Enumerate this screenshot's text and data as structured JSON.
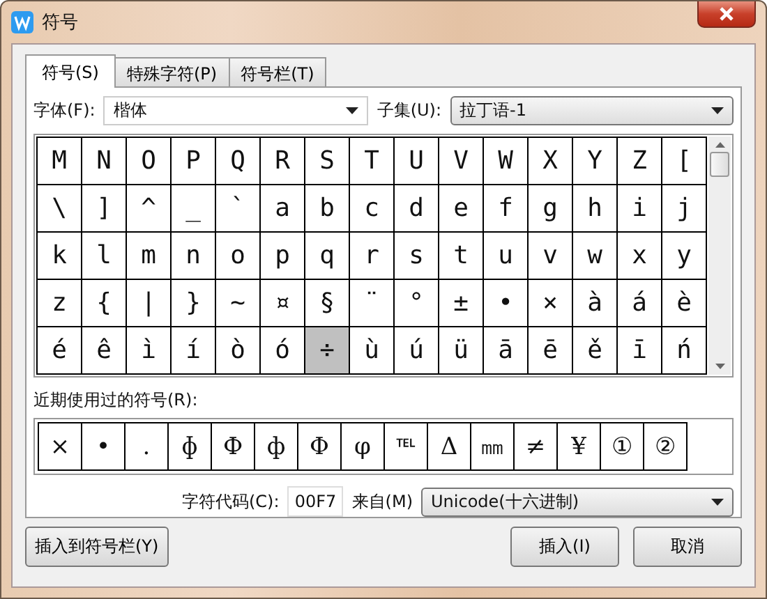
{
  "window": {
    "title": "符号"
  },
  "tabs": [
    {
      "label": "符号(S)",
      "selected": true
    },
    {
      "label": "特殊字符(P)",
      "selected": false
    },
    {
      "label": "符号栏(T)",
      "selected": false
    }
  ],
  "font": {
    "label": "字体(F):",
    "value": "楷体"
  },
  "subset": {
    "label": "子集(U):",
    "value": "拉丁语-1"
  },
  "symbol_grid": [
    [
      {
        "char": "M",
        "selected": false
      },
      {
        "char": "N",
        "selected": false
      },
      {
        "char": "O",
        "selected": false
      },
      {
        "char": "P",
        "selected": false
      },
      {
        "char": "Q",
        "selected": false
      },
      {
        "char": "R",
        "selected": false
      },
      {
        "char": "S",
        "selected": false
      },
      {
        "char": "T",
        "selected": false
      },
      {
        "char": "U",
        "selected": false
      },
      {
        "char": "V",
        "selected": false
      },
      {
        "char": "W",
        "selected": false
      },
      {
        "char": "X",
        "selected": false
      },
      {
        "char": "Y",
        "selected": false
      },
      {
        "char": "Z",
        "selected": false
      },
      {
        "char": "[",
        "selected": false
      }
    ],
    [
      {
        "char": "\\",
        "selected": false
      },
      {
        "char": "]",
        "selected": false
      },
      {
        "char": "^",
        "selected": false
      },
      {
        "char": "_",
        "selected": false
      },
      {
        "char": "`",
        "selected": false
      },
      {
        "char": "a",
        "selected": false
      },
      {
        "char": "b",
        "selected": false
      },
      {
        "char": "c",
        "selected": false
      },
      {
        "char": "d",
        "selected": false
      },
      {
        "char": "e",
        "selected": false
      },
      {
        "char": "f",
        "selected": false
      },
      {
        "char": "g",
        "selected": false
      },
      {
        "char": "h",
        "selected": false
      },
      {
        "char": "i",
        "selected": false
      },
      {
        "char": "j",
        "selected": false
      }
    ],
    [
      {
        "char": "k",
        "selected": false
      },
      {
        "char": "l",
        "selected": false
      },
      {
        "char": "m",
        "selected": false
      },
      {
        "char": "n",
        "selected": false
      },
      {
        "char": "o",
        "selected": false
      },
      {
        "char": "p",
        "selected": false
      },
      {
        "char": "q",
        "selected": false
      },
      {
        "char": "r",
        "selected": false
      },
      {
        "char": "s",
        "selected": false
      },
      {
        "char": "t",
        "selected": false
      },
      {
        "char": "u",
        "selected": false
      },
      {
        "char": "v",
        "selected": false
      },
      {
        "char": "w",
        "selected": false
      },
      {
        "char": "x",
        "selected": false
      },
      {
        "char": "y",
        "selected": false
      }
    ],
    [
      {
        "char": "z",
        "selected": false
      },
      {
        "char": "{",
        "selected": false
      },
      {
        "char": "|",
        "selected": false
      },
      {
        "char": "}",
        "selected": false
      },
      {
        "char": "~",
        "selected": false
      },
      {
        "char": "¤",
        "selected": false
      },
      {
        "char": "§",
        "selected": false
      },
      {
        "char": "¨",
        "selected": false
      },
      {
        "char": "°",
        "selected": false
      },
      {
        "char": "±",
        "selected": false
      },
      {
        "char": "•",
        "selected": false
      },
      {
        "char": "×",
        "selected": false
      },
      {
        "char": "à",
        "selected": false
      },
      {
        "char": "á",
        "selected": false
      },
      {
        "char": "è",
        "selected": false
      }
    ],
    [
      {
        "char": "é",
        "selected": false
      },
      {
        "char": "ê",
        "selected": false
      },
      {
        "char": "ì",
        "selected": false
      },
      {
        "char": "í",
        "selected": false
      },
      {
        "char": "ò",
        "selected": false
      },
      {
        "char": "ó",
        "selected": false
      },
      {
        "char": "÷",
        "selected": true
      },
      {
        "char": "ù",
        "selected": false
      },
      {
        "char": "ú",
        "selected": false
      },
      {
        "char": "ü",
        "selected": false
      },
      {
        "char": "ā",
        "selected": false
      },
      {
        "char": "ē",
        "selected": false
      },
      {
        "char": "ě",
        "selected": false
      },
      {
        "char": "ī",
        "selected": false
      },
      {
        "char": "ń",
        "selected": false
      }
    ]
  ],
  "recent": {
    "label": "近期使用过的符号(R):",
    "symbols": [
      "×",
      "•",
      ".",
      "ɸ",
      "Ф",
      "ф",
      "Φ",
      "φ",
      "℡",
      "Δ",
      "㎜",
      "≠",
      "¥",
      "①",
      "②"
    ]
  },
  "char_code": {
    "label": "字符代码(C):",
    "value": "00F7"
  },
  "from": {
    "label": "来自(M)",
    "value": "Unicode(十六进制)"
  },
  "buttons": [
    "插入到符号栏(Y)",
    "插入(I)",
    "取消"
  ]
}
